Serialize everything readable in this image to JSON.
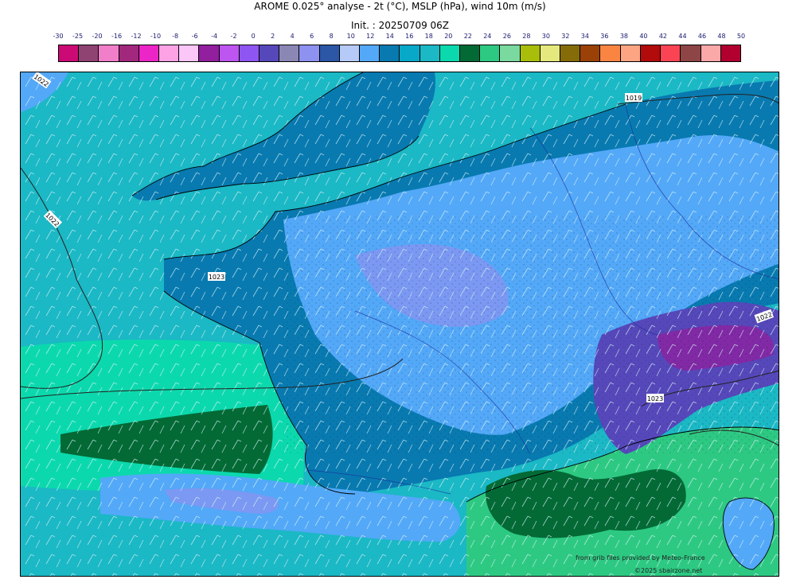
{
  "header": {
    "title": "AROME 0.025° analyse - 2t (°C), MSLP (hPa), wind 10m (m/s)",
    "init": "Init. : 20250709 06Z"
  },
  "colorbar": {
    "ticks": [
      "-30",
      "-25",
      "-20",
      "-16",
      "-12",
      "-10",
      "-8",
      "-6",
      "-4",
      "-2",
      "0",
      "2",
      "4",
      "6",
      "8",
      "10",
      "12",
      "14",
      "16",
      "18",
      "20",
      "22",
      "24",
      "26",
      "28",
      "30",
      "32",
      "34",
      "36",
      "38",
      "40",
      "42",
      "44",
      "46",
      "48",
      "50"
    ],
    "colors": [
      "#cc0a75",
      "#8f4372",
      "#f07ec9",
      "#a2287d",
      "#ec25c6",
      "#fda2e4",
      "#fbc7f9",
      "#911f9e",
      "#bd55f1",
      "#8f55f2",
      "#5648ba",
      "#8b87b5",
      "#8d91ef",
      "#2c57a7",
      "#b6caf7",
      "#53a8f8",
      "#087ab0",
      "#08a8c9",
      "#1bb8c5",
      "#0bd9ad",
      "#036a36",
      "#2dc982",
      "#7ad99e",
      "#a9be0a",
      "#e5e87c",
      "#856c08",
      "#994106",
      "#fa8543",
      "#fda583",
      "#b10b0b",
      "#fa4454",
      "#8d4545",
      "#fba8a8",
      "#b10030"
    ]
  },
  "map": {
    "isobar_labels": [
      "1022",
      "1022",
      "1023",
      "1019",
      "1022",
      "1023"
    ],
    "credits": {
      "provider": "from grib files provided by Meteo-France",
      "copyright": "©2025 sbairzone.net"
    }
  }
}
